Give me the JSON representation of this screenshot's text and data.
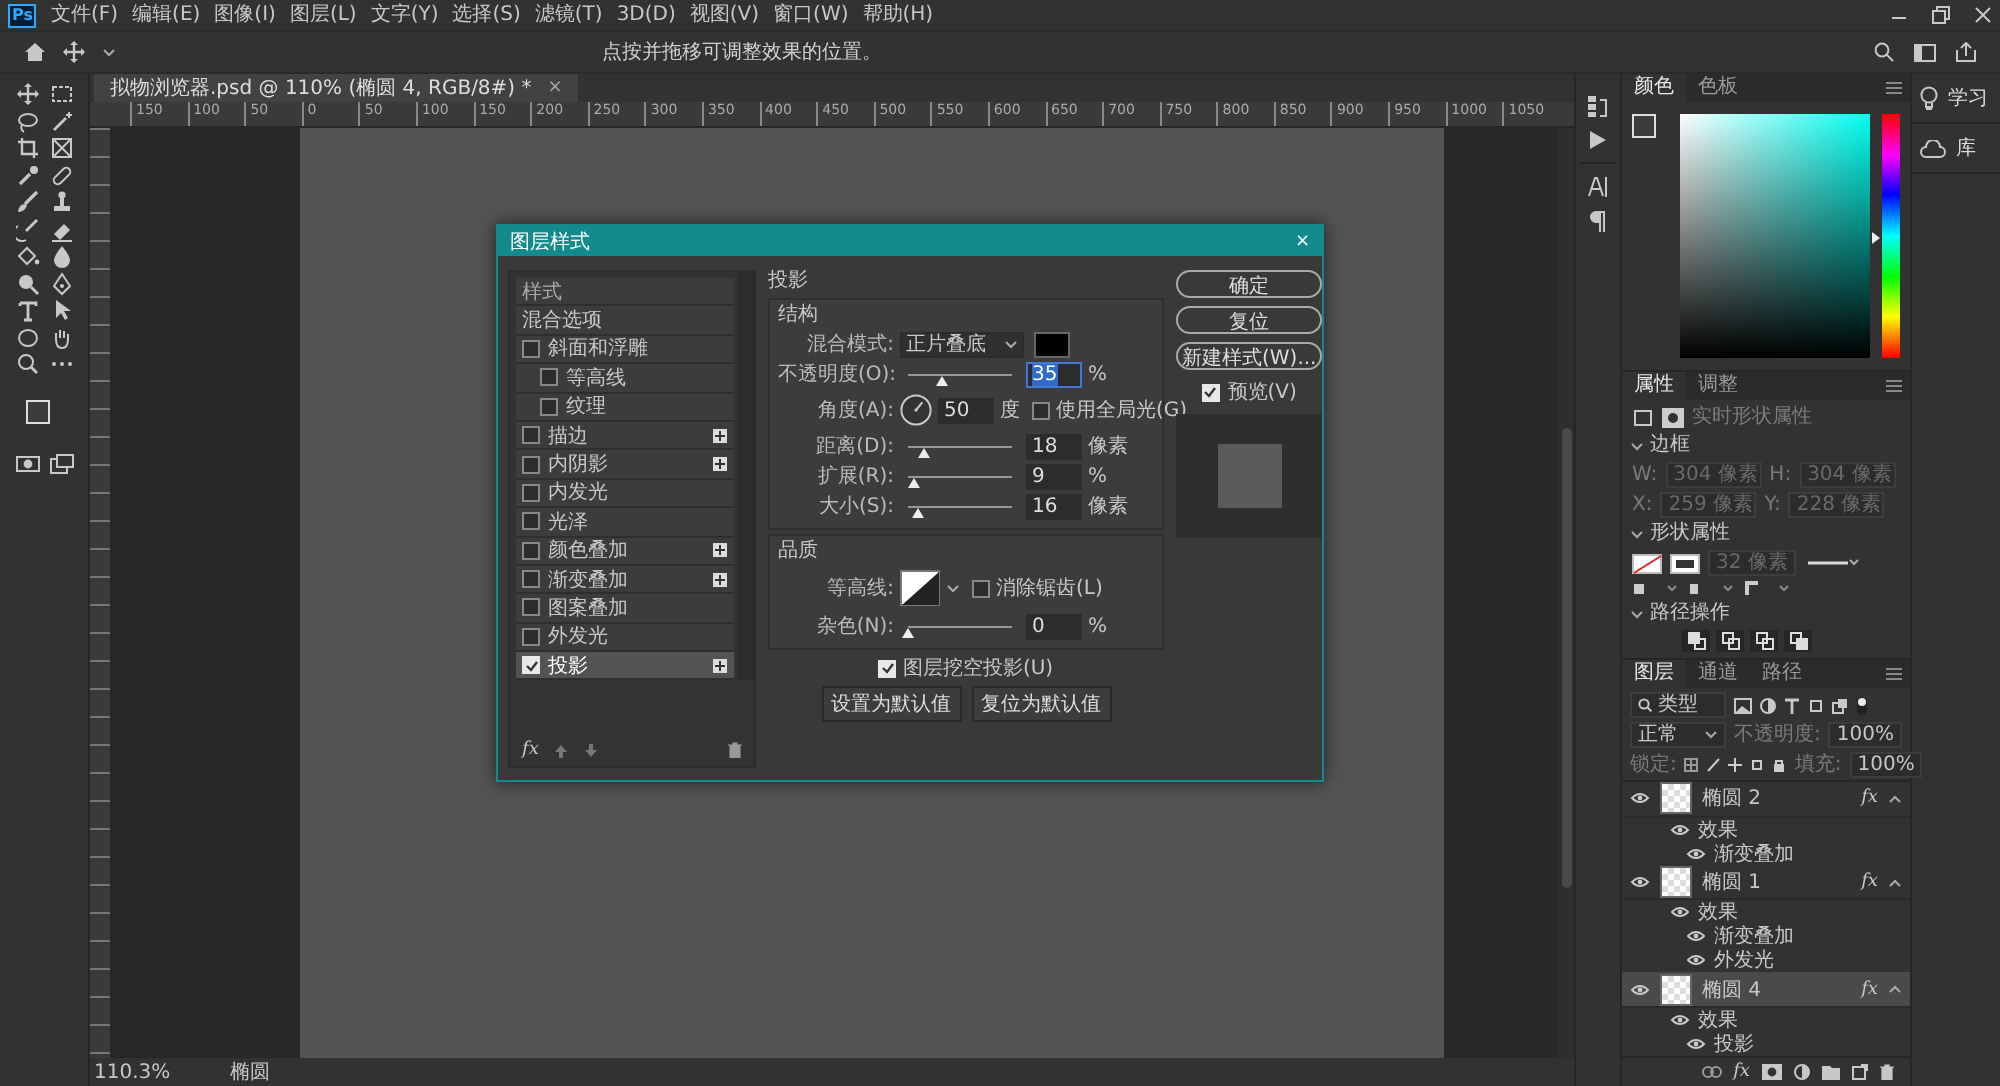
{
  "app_logo": "Ps",
  "menu": {
    "items": [
      "文件(F)",
      "编辑(E)",
      "图像(I)",
      "图层(L)",
      "文字(Y)",
      "选择(S)",
      "滤镜(T)",
      "3D(D)",
      "视图(V)",
      "窗口(W)",
      "帮助(H)"
    ]
  },
  "options_bar": {
    "hint": "点按并拖移可调整效果的位置。"
  },
  "document_tab": {
    "title": "拟物浏览器.psd @ 110% (椭圆 4, RGB/8#) *",
    "close": "×"
  },
  "ruler": {
    "labels": [
      "150",
      "100",
      "50",
      "0",
      "50",
      "100",
      "150",
      "200",
      "250",
      "300",
      "350",
      "400",
      "450",
      "500",
      "550",
      "600",
      "650",
      "700",
      "750",
      "800",
      "850",
      "900",
      "950",
      "1000",
      "1050"
    ]
  },
  "status_bar": {
    "zoom": "110.3%",
    "info": "椭圆"
  },
  "dialog": {
    "title": "图层样式",
    "close": "×",
    "styles": [
      {
        "kind": "title",
        "label": "样式"
      },
      {
        "kind": "item",
        "label": "混合选项",
        "selected": false
      },
      {
        "kind": "check",
        "label": "斜面和浮雕",
        "checked": false,
        "selected": false,
        "addable": false
      },
      {
        "kind": "sub",
        "label": "等高线",
        "checked": false,
        "selected": false,
        "addable": false
      },
      {
        "kind": "sub",
        "label": "纹理",
        "checked": false,
        "selected": false,
        "addable": false
      },
      {
        "kind": "check",
        "label": "描边",
        "checked": false,
        "selected": false,
        "addable": true
      },
      {
        "kind": "check",
        "label": "内阴影",
        "checked": false,
        "selected": false,
        "addable": true
      },
      {
        "kind": "check",
        "label": "内发光",
        "checked": false,
        "selected": false,
        "addable": false
      },
      {
        "kind": "check",
        "label": "光泽",
        "checked": false,
        "selected": false,
        "addable": false
      },
      {
        "kind": "check",
        "label": "颜色叠加",
        "checked": false,
        "selected": false,
        "addable": true
      },
      {
        "kind": "check",
        "label": "渐变叠加",
        "checked": false,
        "selected": false,
        "addable": true
      },
      {
        "kind": "check",
        "label": "图案叠加",
        "checked": false,
        "selected": false,
        "addable": false
      },
      {
        "kind": "check",
        "label": "外发光",
        "checked": false,
        "selected": false,
        "addable": false
      },
      {
        "kind": "check",
        "label": "投影",
        "checked": true,
        "selected": true,
        "addable": true
      }
    ],
    "list_footer": {
      "fx": "fx"
    },
    "section_title": "投影",
    "structure": {
      "title": "结构",
      "rows": [
        {
          "kind": "blend",
          "label": "混合模式:",
          "value": "正片叠底",
          "color": "#000000"
        },
        {
          "kind": "slider",
          "label": "不透明度(O):",
          "level": 0.34,
          "value": "35",
          "unit": "%",
          "focused": true
        },
        {
          "kind": "angle",
          "label": "角度(A):",
          "value": "50",
          "unit": "度",
          "option": {
            "label": "使用全局光(G)",
            "checked": false
          }
        },
        {
          "kind": "slider",
          "label": "距离(D):",
          "level": 0.17,
          "value": "18",
          "unit": "像素",
          "focused": false
        },
        {
          "kind": "slider",
          "label": "扩展(R):",
          "level": 0.07,
          "value": "9",
          "unit": "%",
          "focused": false
        },
        {
          "kind": "slider",
          "label": "大小(S):",
          "level": 0.1,
          "value": "16",
          "unit": "像素",
          "focused": false
        }
      ]
    },
    "quality": {
      "title": "品质",
      "rows": [
        {
          "kind": "contour",
          "label": "等高线:",
          "option": {
            "label": "消除锯齿(L)",
            "checked": false
          }
        },
        {
          "kind": "slider",
          "label": "杂色(N):",
          "level": 0,
          "value": "0",
          "unit": "%",
          "focused": false
        }
      ]
    },
    "knockout": {
      "label": "图层挖空投影(U)",
      "checked": true
    },
    "default_buttons": [
      "设置为默认值",
      "复位为默认值"
    ],
    "buttons": [
      "确定",
      "复位",
      "新建样式(W)..."
    ],
    "preview": {
      "label": "预览(V)",
      "checked": true
    }
  },
  "color_panel": {
    "tabs": [
      {
        "label": "颜色",
        "selected": true
      },
      {
        "label": "色板",
        "selected": false
      }
    ],
    "hue": {
      "level": 0.49
    }
  },
  "properties_panel": {
    "tabs": [
      {
        "label": "属性",
        "selected": true
      },
      {
        "label": "调整",
        "selected": false
      }
    ],
    "subtitle": "实时形状属性",
    "transform": {
      "title": "边框",
      "fields": [
        {
          "label": "W:",
          "value": "304 像素",
          "disabled": true
        },
        {
          "label": "H:",
          "value": "304 像素",
          "disabled": true
        },
        {
          "label": "X:",
          "value": "259 像素",
          "disabled": true
        },
        {
          "label": "Y:",
          "value": "228 像素",
          "disabled": true
        }
      ]
    },
    "appearance": {
      "title": "形状属性",
      "stroke_width": "32 像素"
    },
    "path_ops": {
      "title": "路径操作"
    }
  },
  "layers_panel": {
    "tabs": [
      {
        "label": "图层",
        "selected": true
      },
      {
        "label": "通道",
        "selected": false
      },
      {
        "label": "路径",
        "selected": false
      }
    ],
    "filter": "类型",
    "blend": "正常",
    "opacity_label": "不透明度:",
    "opacity": "100%",
    "lock_label": "锁定:",
    "fill_label": "填充:",
    "fill": "100%",
    "layers": [
      {
        "name": "椭圆 2",
        "fx": "fx",
        "selected": false,
        "effects_label": "效果",
        "effects": [
          "渐变叠加"
        ]
      },
      {
        "name": "椭圆 1",
        "fx": "fx",
        "selected": false,
        "effects_label": "效果",
        "effects": [
          "渐变叠加",
          "外发光"
        ]
      },
      {
        "name": "椭圆 4",
        "fx": "fx",
        "selected": true,
        "effects_label": "效果",
        "effects": [
          "投影"
        ]
      }
    ],
    "footer_fx": "fx"
  },
  "side_panels": [
    {
      "label": "学习"
    },
    {
      "label": "库"
    }
  ]
}
